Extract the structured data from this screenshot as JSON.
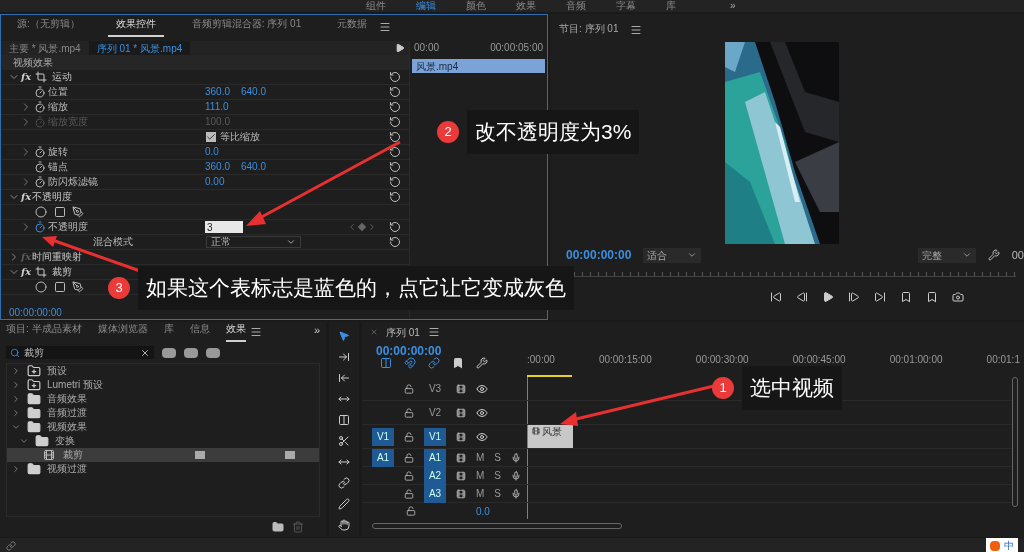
{
  "workspace_tabs": [
    {
      "label": "组件",
      "selected": false
    },
    {
      "label": "编辑",
      "selected": true
    },
    {
      "label": "颜色",
      "selected": false
    },
    {
      "label": "效果",
      "selected": false
    },
    {
      "label": "音频",
      "selected": false
    },
    {
      "label": "字幕",
      "selected": false
    },
    {
      "label": "库",
      "selected": false
    }
  ],
  "workspace_more": "»",
  "effect_controls": {
    "tabs": [
      {
        "label": "源:（无剪辑）",
        "selected": false
      },
      {
        "label": "效果控件",
        "selected": true
      },
      {
        "label": "音频剪辑混合器: 序列 01",
        "selected": false
      },
      {
        "label": "元数据",
        "selected": false
      }
    ],
    "clip_tabs": [
      {
        "label": "主要 * 风景.mp4",
        "selected": false
      },
      {
        "label": "序列 01 * 风景.mp4",
        "selected": true
      }
    ],
    "section": "视频效果",
    "rows": [
      {
        "kind": "effect",
        "fx": "fx",
        "label": "运动",
        "expanded": true,
        "enabled": true,
        "transform": true,
        "reset": true
      },
      {
        "kind": "param",
        "label": "位置",
        "values": [
          "360.0",
          "640.0"
        ],
        "expandable": false,
        "disabled": false,
        "animated": false
      },
      {
        "kind": "param",
        "label": "缩放",
        "values": [
          "111.0"
        ],
        "expandable": true,
        "disabled": false,
        "animated": false
      },
      {
        "kind": "param",
        "label": "缩放宽度",
        "values": [
          "100.0"
        ],
        "expandable": true,
        "disabled": true,
        "animated": false
      },
      {
        "kind": "checkbox",
        "label": "等比缩放",
        "checked": true
      },
      {
        "kind": "param",
        "label": "旋转",
        "values": [
          "0.0"
        ],
        "expandable": true,
        "disabled": false,
        "animated": false
      },
      {
        "kind": "param",
        "label": "锚点",
        "values": [
          "360.0",
          "640.0"
        ],
        "expandable": false,
        "disabled": false,
        "animated": false
      },
      {
        "kind": "param",
        "label": "防闪烁滤镜",
        "values": [
          "0.00"
        ],
        "expandable": true,
        "disabled": false,
        "animated": false
      },
      {
        "kind": "effect",
        "fx": "fx",
        "label": "不透明度",
        "expanded": true,
        "enabled": true,
        "transform": false,
        "reset": true
      },
      {
        "kind": "masks"
      },
      {
        "kind": "input",
        "label": "不透明度",
        "value": "3",
        "animated": true
      },
      {
        "kind": "dropdown",
        "label": "混合模式",
        "value": "正常"
      },
      {
        "kind": "effect",
        "fx": "fx",
        "label": "时间重映射",
        "expanded": false,
        "enabled": false,
        "transform": false
      },
      {
        "kind": "effect",
        "fx": "fx",
        "label": "裁剪",
        "expanded": true,
        "enabled": true,
        "transform": true
      },
      {
        "kind": "masks"
      }
    ],
    "timecode": "00:00:00:00",
    "mini_timeline": {
      "ticks": [
        "00:00",
        "00:00:05:00"
      ],
      "clip": "风景.mp4"
    }
  },
  "program_monitor": {
    "title": "节目: 序列 01",
    "timecode": "00:00:00:00",
    "zoom": "适合",
    "quality": "完整",
    "cut_timecode": "00"
  },
  "effects_panel": {
    "tabs": [
      {
        "label": "项目: 半成品素材",
        "selected": false
      },
      {
        "label": "媒体浏览器",
        "selected": false
      },
      {
        "label": "库",
        "selected": false
      },
      {
        "label": "信息",
        "selected": false
      },
      {
        "label": "效果",
        "selected": true
      }
    ],
    "more": "»",
    "search": "裁剪",
    "tree": [
      {
        "label": "预设",
        "kind": "preset",
        "expanded": false,
        "selected": false
      },
      {
        "label": "Lumetri 预设",
        "kind": "preset",
        "expanded": false,
        "selected": false
      },
      {
        "label": "音频效果",
        "kind": "folder",
        "expanded": false,
        "selected": false
      },
      {
        "label": "音频过渡",
        "kind": "folder",
        "expanded": false,
        "selected": false
      },
      {
        "label": "视频效果",
        "kind": "folder",
        "expanded": true,
        "selected": false,
        "children": [
          {
            "label": "变换",
            "kind": "folder",
            "expanded": true,
            "selected": false,
            "children": [
              {
                "label": "裁剪",
                "kind": "effect",
                "selected": true
              }
            ]
          }
        ]
      },
      {
        "label": "视频过渡",
        "kind": "folder",
        "expanded": false,
        "selected": false
      }
    ]
  },
  "timeline": {
    "title": "序列 01",
    "timecode": "00:00:00:00",
    "ruler": [
      ":00:00",
      "00:00:15:00",
      "00:00:30:00",
      "00:00:45:00",
      "00:01:00:00",
      "00:01:1"
    ],
    "tracks": [
      {
        "name": "V3",
        "kind": "video",
        "targeted": false
      },
      {
        "name": "V2",
        "kind": "video",
        "targeted": false
      },
      {
        "name": "V1",
        "kind": "video",
        "targeted": true,
        "source": "V1"
      },
      {
        "name": "A1",
        "kind": "audio",
        "targeted": true,
        "source": "A1",
        "mute": "M",
        "solo": "S"
      },
      {
        "name": "A2",
        "kind": "audio",
        "targeted": true,
        "mute": "M",
        "solo": "S"
      },
      {
        "name": "A3",
        "kind": "audio",
        "targeted": true,
        "mute": "M",
        "solo": "S"
      }
    ],
    "master_level": "0.0",
    "clip": "风景"
  },
  "callouts": [
    {
      "number": "1",
      "text": "选中视频"
    },
    {
      "number": "2",
      "text": "改不透明度为3%"
    },
    {
      "number": "3",
      "text": "如果这个表标志是蓝色的，点它让它变成灰色"
    }
  ],
  "ime": "中"
}
